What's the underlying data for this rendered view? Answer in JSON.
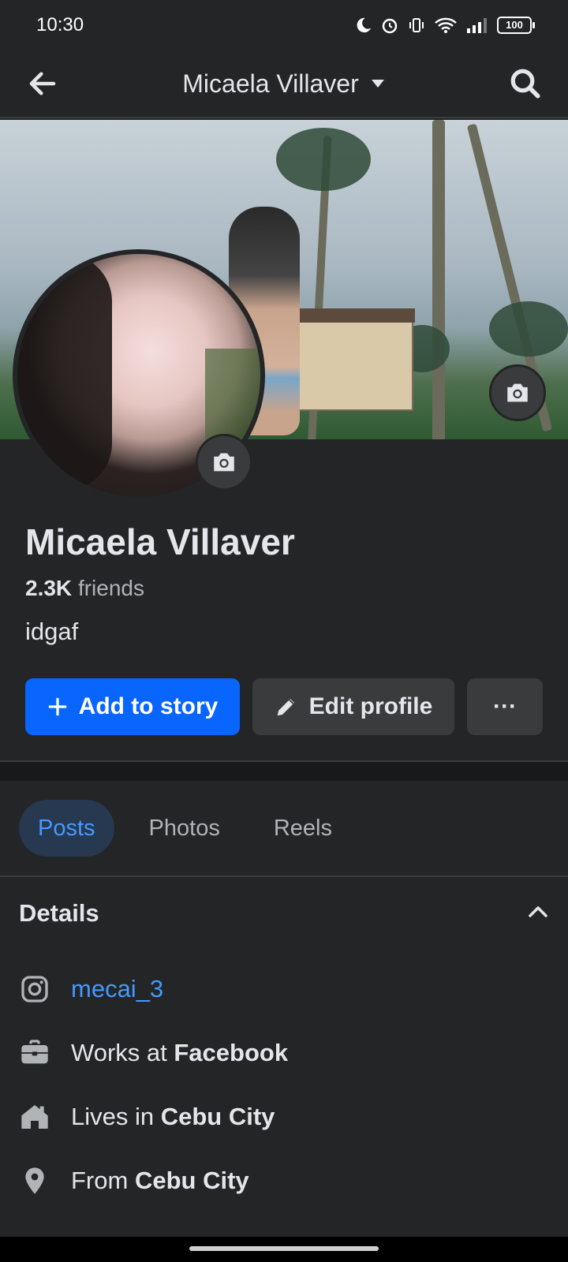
{
  "status": {
    "time": "10:30",
    "battery": "100"
  },
  "header": {
    "title": "Micaela Villaver"
  },
  "profile": {
    "name": "Micaela Villaver",
    "friends_count": "2.3K",
    "friends_label": "friends",
    "bio": "idgaf"
  },
  "actions": {
    "add_story": "Add to story",
    "edit_profile": "Edit profile",
    "more": "···"
  },
  "tabs": [
    {
      "label": "Posts",
      "active": true
    },
    {
      "label": "Photos",
      "active": false
    },
    {
      "label": "Reels",
      "active": false
    }
  ],
  "details": {
    "title": "Details",
    "instagram": "mecai_3",
    "works_prefix": "Works at",
    "works_value": "Facebook",
    "lives_prefix": "Lives in",
    "lives_value": "Cebu City",
    "from_prefix": "From",
    "from_value": "Cebu City"
  },
  "colors": {
    "background": "#242526",
    "primary": "#0866ff",
    "link": "#4599ff",
    "active_tab_bg": "#263951"
  }
}
